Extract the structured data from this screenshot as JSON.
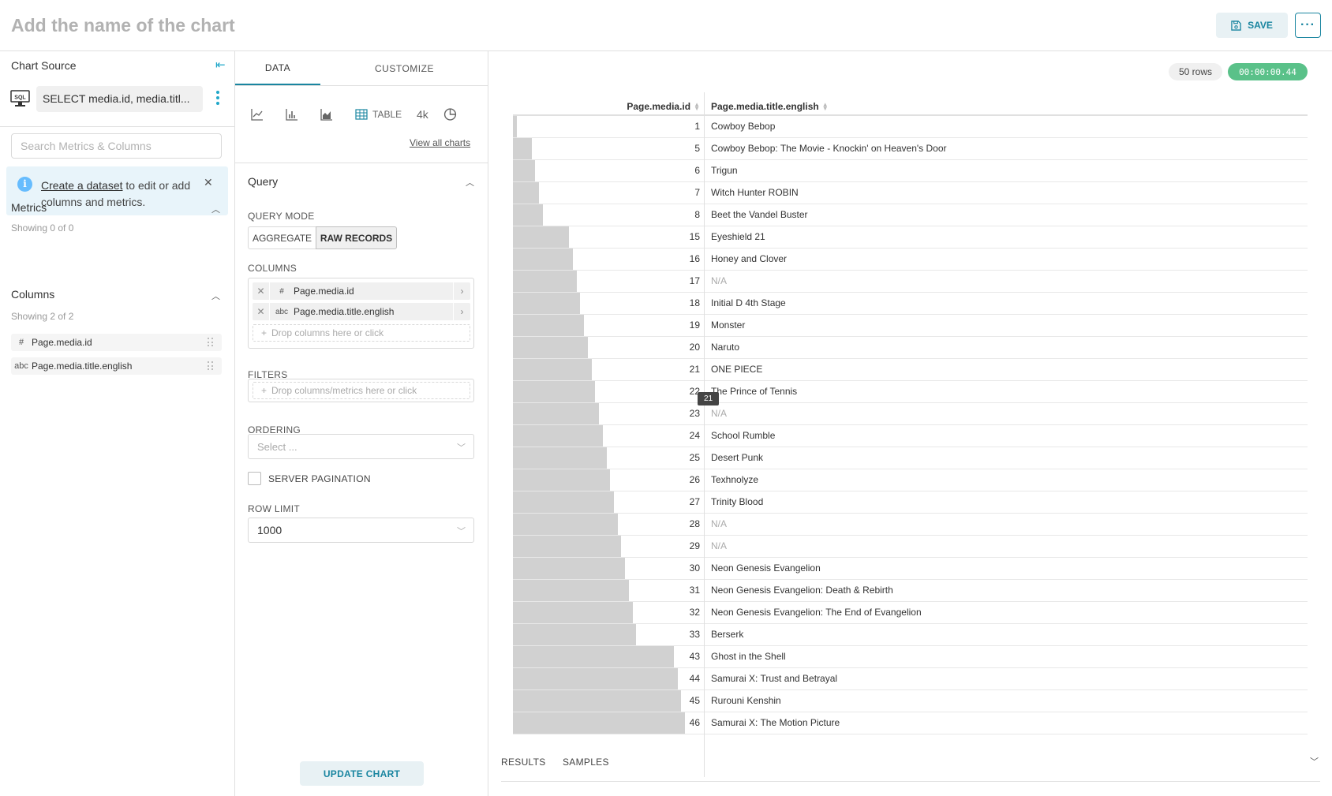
{
  "header": {
    "chart_name_placeholder": "Add the name of the chart",
    "save_label": "SAVE",
    "more_label": "···"
  },
  "left": {
    "title": "Chart Source",
    "sql_badge": "SQL",
    "source_text": "SELECT media.id, media.titl...",
    "search_placeholder": "Search Metrics & Columns",
    "info": {
      "link": "Create a dataset",
      "text": " to edit or add columns and metrics."
    },
    "metrics": {
      "title": "Metrics",
      "sub": "Showing 0 of 0"
    },
    "columns": {
      "title": "Columns",
      "sub": "Showing 2 of 2",
      "items": [
        {
          "type": "#",
          "label": "Page.media.id"
        },
        {
          "type": "abc",
          "label": "Page.media.title.english"
        }
      ]
    }
  },
  "mid": {
    "tabs": [
      "DATA",
      "CUSTOMIZE"
    ],
    "viz": {
      "table_label": "TABLE",
      "big_number_label": "4k"
    },
    "view_all": "View all charts",
    "query": {
      "title": "Query",
      "mode_label": "QUERY MODE",
      "modes": [
        "AGGREGATE",
        "RAW RECORDS"
      ],
      "columns_label": "COLUMNS",
      "columns": [
        {
          "type": "#",
          "label": "Page.media.id"
        },
        {
          "type": "abc",
          "label": "Page.media.title.english"
        }
      ],
      "columns_drop": "Drop columns here or click",
      "filters_label": "FILTERS",
      "filters_drop": "Drop columns/metrics here or click",
      "ordering_label": "ORDERING",
      "ordering_placeholder": "Select ...",
      "server_pagination": "SERVER PAGINATION",
      "row_limit_label": "ROW LIMIT",
      "row_limit_value": "1000"
    },
    "update_label": "UPDATE CHART"
  },
  "right": {
    "rows_badge": "50 rows",
    "time_badge": "00:00:00.44",
    "headers": [
      "Page.media.id",
      "Page.media.title.english"
    ],
    "tooltip": "21",
    "max_id": 50,
    "rows": [
      {
        "id": "1",
        "title": "Cowboy Bebop"
      },
      {
        "id": "5",
        "title": "Cowboy Bebop: The Movie - Knockin' on Heaven's Door"
      },
      {
        "id": "6",
        "title": "Trigun"
      },
      {
        "id": "7",
        "title": "Witch Hunter ROBIN"
      },
      {
        "id": "8",
        "title": "Beet the Vandel Buster"
      },
      {
        "id": "15",
        "title": "Eyeshield 21"
      },
      {
        "id": "16",
        "title": "Honey and Clover"
      },
      {
        "id": "17",
        "title": "N/A"
      },
      {
        "id": "18",
        "title": "Initial D 4th Stage"
      },
      {
        "id": "19",
        "title": "Monster"
      },
      {
        "id": "20",
        "title": "Naruto"
      },
      {
        "id": "21",
        "title": "ONE PIECE"
      },
      {
        "id": "22",
        "title": "The Prince of Tennis"
      },
      {
        "id": "23",
        "title": "N/A"
      },
      {
        "id": "24",
        "title": "School Rumble"
      },
      {
        "id": "25",
        "title": "Desert Punk"
      },
      {
        "id": "26",
        "title": "Texhnolyze"
      },
      {
        "id": "27",
        "title": "Trinity Blood"
      },
      {
        "id": "28",
        "title": "N/A"
      },
      {
        "id": "29",
        "title": "N/A"
      },
      {
        "id": "30",
        "title": "Neon Genesis Evangelion"
      },
      {
        "id": "31",
        "title": "Neon Genesis Evangelion: Death & Rebirth"
      },
      {
        "id": "32",
        "title": "Neon Genesis Evangelion: The End of Evangelion"
      },
      {
        "id": "33",
        "title": "Berserk"
      },
      {
        "id": "43",
        "title": "Ghost in the Shell"
      },
      {
        "id": "44",
        "title": "Samurai X: Trust and Betrayal"
      },
      {
        "id": "45",
        "title": "Rurouni Kenshin"
      },
      {
        "id": "46",
        "title": "Samurai X: The Motion Picture"
      }
    ],
    "bottom_tabs": [
      "RESULTS",
      "SAMPLES"
    ]
  }
}
